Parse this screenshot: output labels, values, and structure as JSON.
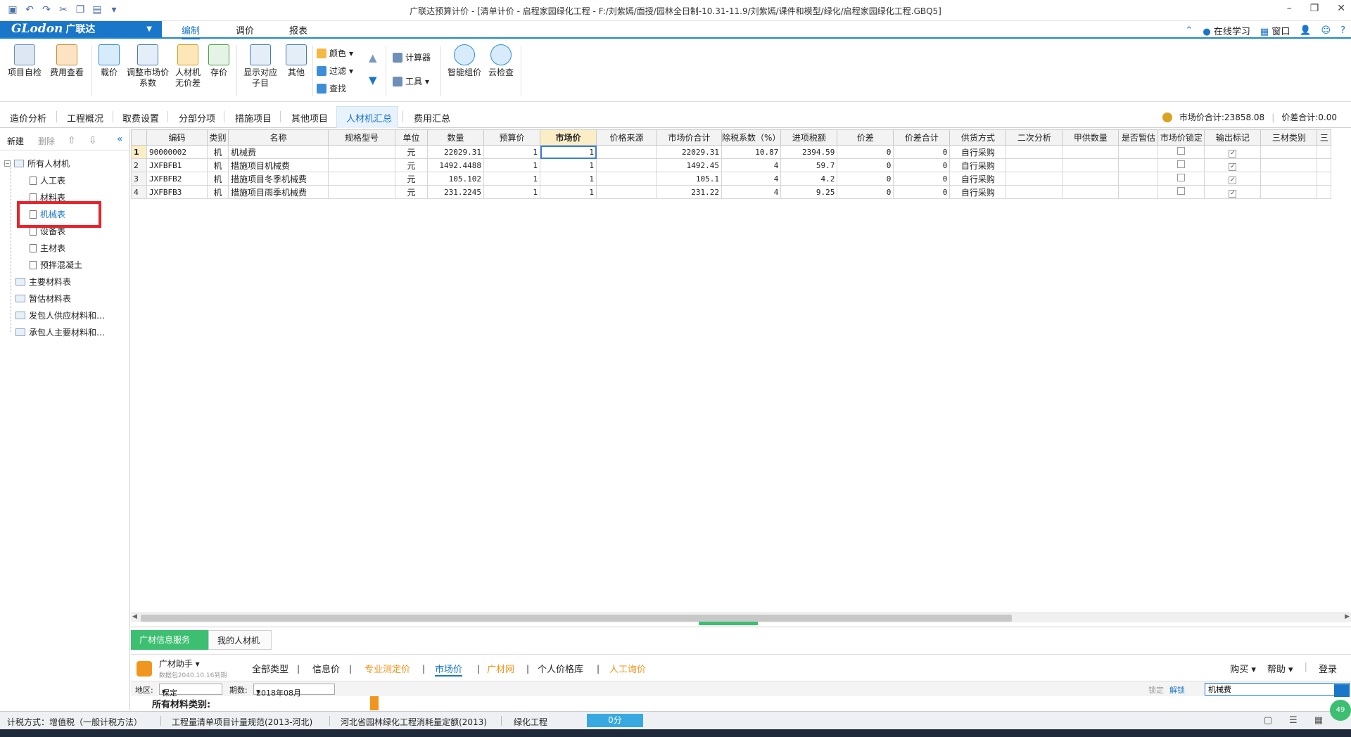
{
  "window": {
    "title": "广联达预算计价 - [清单计价 - 启程家园绿化工程 - F:/刘紫嫣/面授/园林全日制-10.31-11.9/刘紫嫣/课件和模型/绿化/启程家园绿化工程.GBQ5]"
  },
  "menubar": {
    "logo_en": "GLodon",
    "logo_cn": "广联达",
    "tabs": [
      {
        "label": "编制",
        "active": true
      },
      {
        "label": "调价",
        "active": false
      },
      {
        "label": "报表",
        "active": false
      }
    ],
    "online_learning": "在线学习",
    "window_menu": "窗口"
  },
  "ribbon": {
    "project_check": "项目自检",
    "fee_view": "费用查看",
    "load_price": "载价",
    "adjust_market_1": "调整市场价",
    "adjust_market_2": "系数",
    "labor_material_1": "人材机",
    "labor_material_2": "无价差",
    "save_price": "存价",
    "show_sub_1": "显示对应",
    "show_sub_2": "子目",
    "other": "其他",
    "color": "颜色",
    "filter": "过滤",
    "find": "查找",
    "calculator": "计算器",
    "tools": "工具",
    "smart_price": "智能组价",
    "cloud_check": "云检查"
  },
  "tabs": [
    {
      "label": "造价分析"
    },
    {
      "label": "工程概况"
    },
    {
      "label": "取费设置"
    },
    {
      "label": "分部分项"
    },
    {
      "label": "措施项目"
    },
    {
      "label": "其他项目"
    },
    {
      "label": "人材机汇总"
    },
    {
      "label": "费用汇总"
    }
  ],
  "totals": {
    "market_total": "市场价合计:23858.08",
    "diff_total": "价差合计:0.00"
  },
  "sidebar": {
    "new": "新建",
    "delete": "删除",
    "tree": [
      {
        "label": "所有人材机"
      },
      {
        "label": "人工表"
      },
      {
        "label": "材料表"
      },
      {
        "label": "机械表"
      },
      {
        "label": "设备表"
      },
      {
        "label": "主材表"
      },
      {
        "label": "预拌混凝土"
      },
      {
        "label": "主要材料表"
      },
      {
        "label": "暂估材料表"
      },
      {
        "label": "发包人供应材料和…"
      },
      {
        "label": "承包人主要材料和…"
      }
    ]
  },
  "grid": {
    "columns": [
      "编码",
      "类别",
      "名称",
      "规格型号",
      "单位",
      "数量",
      "预算价",
      "市场价",
      "价格来源",
      "市场价合计",
      "除税系数（%）",
      "进项税额",
      "价差",
      "价差合计",
      "供货方式",
      "二次分析",
      "甲供数量",
      "是否暂估",
      "市场价锁定",
      "输出标记",
      "三材类别",
      "三"
    ],
    "rows": [
      {
        "n": "1",
        "code": "90000002",
        "cat": "机",
        "name": "机械费",
        "spec": "",
        "unit": "元",
        "qty": "22029.31",
        "budget": "1",
        "market": "1",
        "source": "",
        "market_total": "22029.31",
        "tax_coef": "10.87",
        "input_tax": "2394.59",
        "diff": "0",
        "diff_total": "0",
        "supply": "自行采购"
      },
      {
        "n": "2",
        "code": "JXFBFB1",
        "cat": "机",
        "name": "措施项目机械费",
        "spec": "",
        "unit": "元",
        "qty": "1492.4488",
        "budget": "1",
        "market": "1",
        "source": "",
        "market_total": "1492.45",
        "tax_coef": "4",
        "input_tax": "59.7",
        "diff": "0",
        "diff_total": "0",
        "supply": "自行采购"
      },
      {
        "n": "3",
        "code": "JXFBFB2",
        "cat": "机",
        "name": "措施项目冬季机械费",
        "spec": "",
        "unit": "元",
        "qty": "105.102",
        "budget": "1",
        "market": "1",
        "source": "",
        "market_total": "105.1",
        "tax_coef": "4",
        "input_tax": "4.2",
        "diff": "0",
        "diff_total": "0",
        "supply": "自行采购"
      },
      {
        "n": "4",
        "code": "JXFBFB3",
        "cat": "机",
        "name": "措施项目雨季机械费",
        "spec": "",
        "unit": "元",
        "qty": "231.2245",
        "budget": "1",
        "market": "1",
        "source": "",
        "market_total": "231.22",
        "tax_coef": "4",
        "input_tax": "9.25",
        "diff": "0",
        "diff_total": "0",
        "supply": "自行采购"
      }
    ]
  },
  "bottom": {
    "tab_service": "广材信息服务",
    "tab_mine": "我的人材机",
    "assistant": "广材助手",
    "assistant_sub": "数据包2040.10.16到期",
    "filters": [
      {
        "label": "全部类型",
        "style": "normal"
      },
      {
        "label": "信息价",
        "style": "normal"
      },
      {
        "label": "专业测定价",
        "style": "orange"
      },
      {
        "label": "市场价",
        "style": "blue"
      },
      {
        "label": "广材网",
        "style": "orange"
      },
      {
        "label": "个人价格库",
        "style": "normal"
      },
      {
        "label": "人工询价",
        "style": "orange"
      }
    ],
    "buy": "购买",
    "help": "帮助",
    "login": "登录",
    "region_label": "地区:",
    "region_value": "保定",
    "period_label": "期数:",
    "period_value": "2018年08月",
    "lock": "锁定",
    "unlock": "解锁",
    "search_value": "机械费",
    "category_title": "所有材料类别:"
  },
  "statusbar": {
    "tax": "计税方式：增值税（一般计税方法）",
    "spec": "工程量清单项目计量规范(2013-河北)",
    "quota": "河北省园林绿化工程消耗量定额(2013)",
    "project": "绿化工程",
    "score": "0分"
  },
  "badge": "49"
}
